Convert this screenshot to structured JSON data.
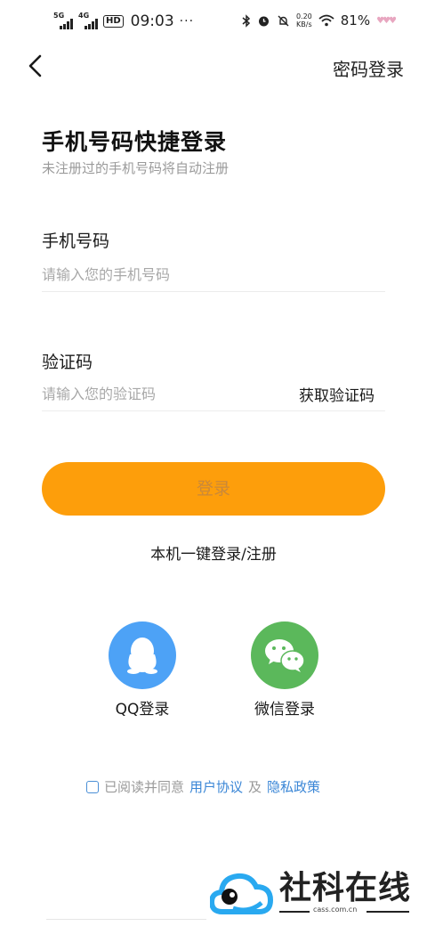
{
  "status_bar": {
    "signal1": "5G",
    "signal2": "4G",
    "hd": "HD",
    "time": "09:03",
    "more": "···",
    "net_speed_value": "0.20",
    "net_speed_unit": "KB/s",
    "battery": "81%"
  },
  "header": {
    "password_login": "密码登录"
  },
  "main": {
    "title": "手机号码快捷登录",
    "subtitle": "未注册过的手机号码将自动注册",
    "phone_label": "手机号码",
    "phone_placeholder": "请输入您的手机号码",
    "code_label": "验证码",
    "code_placeholder": "请输入您的验证码",
    "get_code": "获取验证码",
    "login_button": "登录",
    "quick_login": "本机一键登录/注册"
  },
  "social": {
    "qq_label": "QQ登录",
    "wechat_label": "微信登录"
  },
  "agreement": {
    "prefix": "已阅读并同意",
    "user_agreement": "用户协议",
    "and": "及",
    "privacy_policy": "隐私政策"
  },
  "watermark": {
    "text": "社科在线",
    "url": "cass.com.cn"
  },
  "colors": {
    "accent": "#fd9e0b",
    "qq": "#4da2f6",
    "wechat": "#5bb85b",
    "link": "#3a86d6"
  }
}
